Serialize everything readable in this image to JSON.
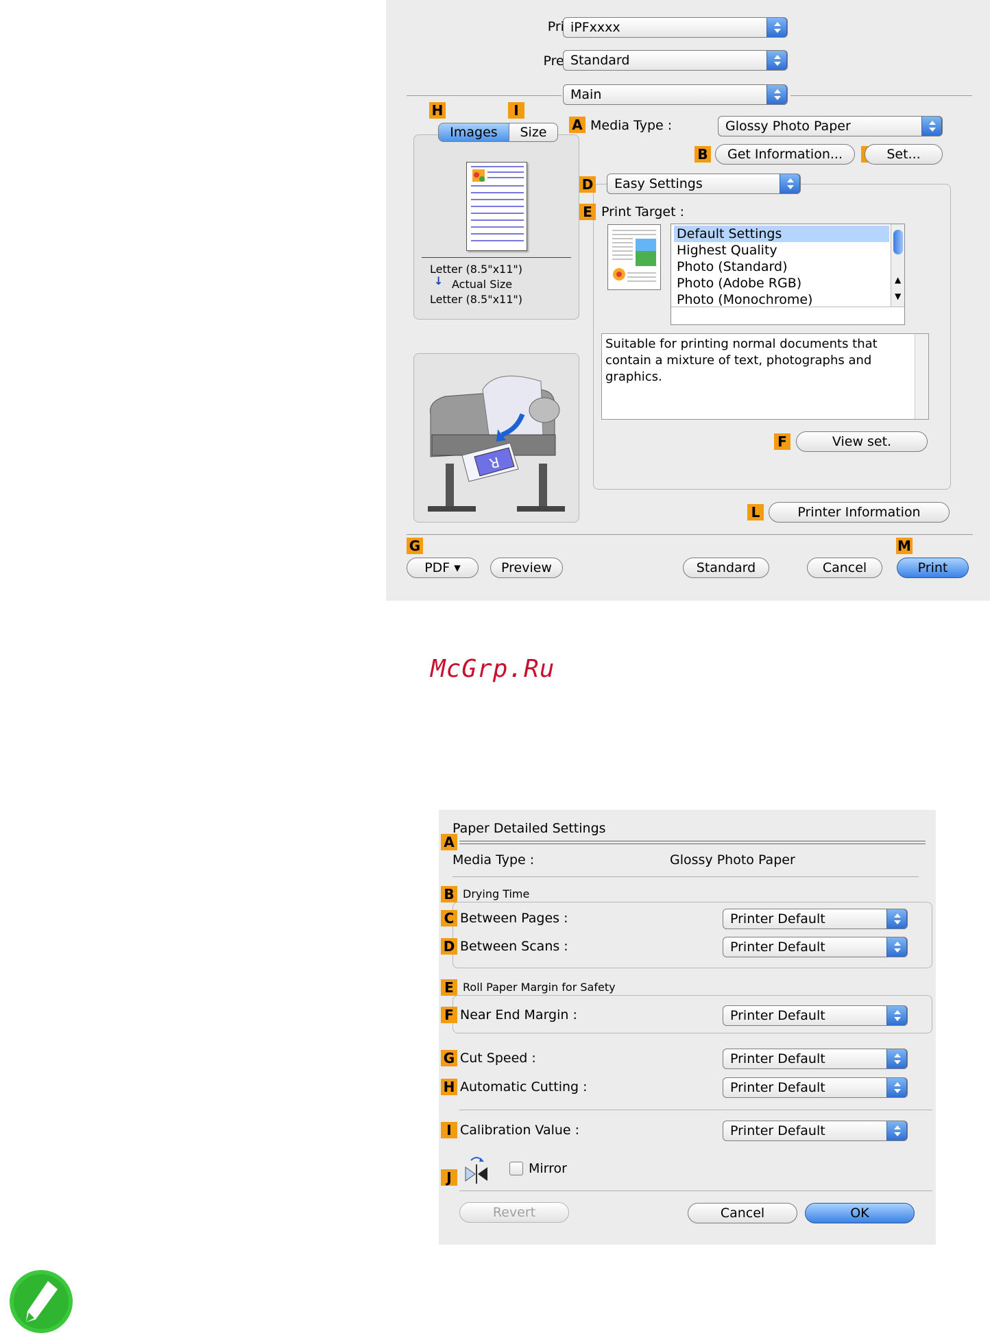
{
  "print_dialog": {
    "printer_label": "Printer:",
    "printer_value": "iPFxxxx",
    "presets_label": "Presets:",
    "presets_value": "Standard",
    "section_value": "Main",
    "tabs": [
      "Images",
      "Size"
    ],
    "paper_info": {
      "line1": "Letter (8.5\"x11\")",
      "line2": "Actual Size",
      "line3": "Letter (8.5\"x11\")"
    },
    "media_type_label": "Media Type :",
    "media_type_value": "Glossy Photo Paper",
    "get_information_label": "Get Information...",
    "set_label": "Set...",
    "mode_value": "Easy Settings",
    "print_target_label": "Print Target :",
    "print_targets": [
      "Default Settings",
      "Highest Quality",
      "Photo (Standard)",
      "Photo (Adobe RGB)",
      "Photo (Monochrome)"
    ],
    "selected_target": "Default Settings",
    "description": "Suitable for printing normal documents that contain a mixture of text, photographs and graphics.",
    "view_set_label": "View set.",
    "printer_information_label": "Printer Information",
    "pdf_label": "PDF ▾",
    "preview_label": "Preview",
    "standard_label": "Standard",
    "cancel_label": "Cancel",
    "print_label": "Print",
    "markers": {
      "A": "A",
      "B": "B",
      "C": "C",
      "D": "D",
      "E": "E",
      "F": "F",
      "G": "G",
      "H": "H",
      "I": "I",
      "L": "L",
      "M": "M"
    }
  },
  "watermark": "McGrp.Ru",
  "paper_dialog": {
    "title": "Paper Detailed Settings",
    "media_type_label": "Media Type :",
    "media_type_value": "Glossy Photo Paper",
    "drying_time_label": "Drying Time",
    "between_pages_label": "Between Pages :",
    "between_pages_value": "Printer Default",
    "between_scans_label": "Between Scans :",
    "between_scans_value": "Printer Default",
    "roll_margin_label": "Roll Paper Margin for Safety",
    "near_end_label": "Near End Margin :",
    "near_end_value": "Printer Default",
    "cut_speed_label": "Cut Speed :",
    "cut_speed_value": "Printer Default",
    "auto_cutting_label": "Automatic Cutting :",
    "auto_cutting_value": "Printer Default",
    "calibration_label": "Calibration Value :",
    "calibration_value": "Printer Default",
    "mirror_label": "Mirror",
    "mirror_checked": false,
    "revert_label": "Revert",
    "cancel_label": "Cancel",
    "ok_label": "OK",
    "markers": {
      "A": "A",
      "B": "B",
      "C": "C",
      "D": "D",
      "E": "E",
      "F": "F",
      "G": "G",
      "H": "H",
      "I": "I",
      "J": "J"
    }
  },
  "colors": {
    "marker": "#f39c12",
    "accent": "#3b82e6",
    "note_icon": "#3cc83c"
  },
  "icons": [
    "popup-arrows-icon",
    "down-arrow-icon",
    "printer-illustration-icon",
    "document-preview-icon",
    "mirror-icon",
    "note-pencil-icon"
  ]
}
